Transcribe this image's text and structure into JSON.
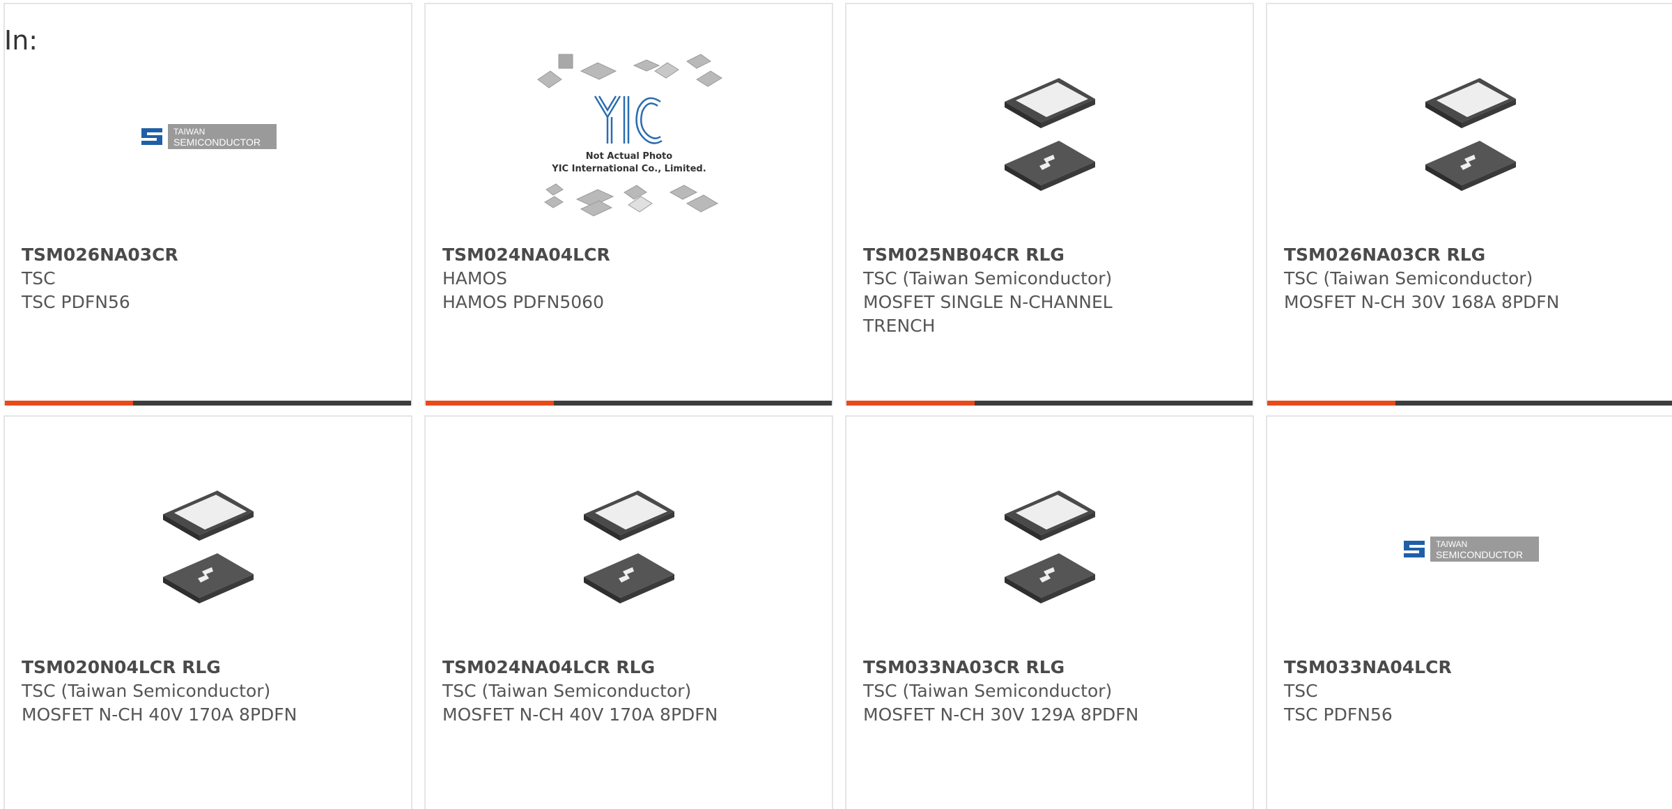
{
  "header": {
    "in_label": "In:"
  },
  "cards": [
    {
      "part": "TSM026NA03CR",
      "brand": "TSC",
      "desc": "TSC PDFN56",
      "image": "taiwan-semiconductor-logo",
      "logo_text_1": "TAIWAN",
      "logo_text_2": "SEMICONDUCTOR"
    },
    {
      "part": "TSM024NA04LCR",
      "brand": "HAMOS",
      "desc": "HAMOS PDFN5060",
      "image": "yic-placeholder-photo",
      "caption_1": "Not Actual Photo",
      "caption_2": "YIC International Co., Limited."
    },
    {
      "part": "TSM025NB04CR RLG",
      "brand": "TSC (Taiwan Semiconductor)",
      "desc": "MOSFET SINGLE N-CHANNEL TRENCH",
      "image": "pdfn-chip-photo"
    },
    {
      "part": "TSM026NA03CR RLG",
      "brand": "TSC (Taiwan Semiconductor)",
      "desc": "MOSFET N-CH 30V 168A 8PDFN",
      "image": "pdfn-chip-photo"
    },
    {
      "part": "TSM020N04LCR RLG",
      "brand": "TSC (Taiwan Semiconductor)",
      "desc": "MOSFET N-CH 40V 170A 8PDFN",
      "image": "pdfn-chip-photo"
    },
    {
      "part": "TSM024NA04LCR RLG",
      "brand": "TSC (Taiwan Semiconductor)",
      "desc": "MOSFET N-CH 40V 170A 8PDFN",
      "image": "pdfn-chip-photo"
    },
    {
      "part": "TSM033NA03CR RLG",
      "brand": "TSC (Taiwan Semiconductor)",
      "desc": "MOSFET N-CH 30V 129A 8PDFN",
      "image": "pdfn-chip-photo"
    },
    {
      "part": "TSM033NA04LCR",
      "brand": "TSC",
      "desc": "TSC PDFN56",
      "image": "taiwan-semiconductor-logo",
      "logo_text_1": "TAIWAN",
      "logo_text_2": "SEMICONDUCTOR"
    }
  ],
  "colors": {
    "accent": "#e84a1a",
    "bar": "#3d3d3d",
    "logo_blue": "#1f5fa8",
    "logo_gray": "#9a9a9a"
  }
}
